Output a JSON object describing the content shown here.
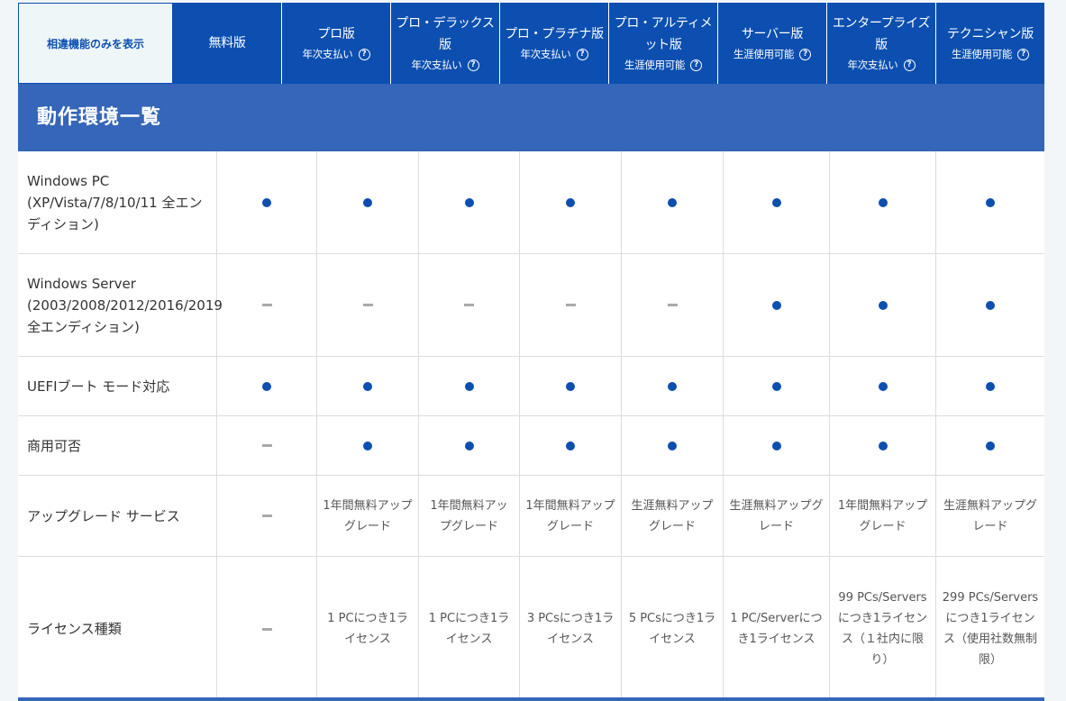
{
  "header": {
    "toggle_label": "相違機能のみを表示",
    "plans": [
      {
        "name": "無料版",
        "sub": ""
      },
      {
        "name": "プロ版",
        "sub": "年次支払い"
      },
      {
        "name": "プロ・デラックス版",
        "sub": "年次支払い"
      },
      {
        "name": "プロ・プラチナ版",
        "sub": "年次支払い"
      },
      {
        "name": "プロ・アルティメット版",
        "sub": "生涯使用可能"
      },
      {
        "name": "サーバー版",
        "sub": "生涯使用可能"
      },
      {
        "name": "エンタープライズ版",
        "sub": "年次支払い"
      },
      {
        "name": "テクニシャン版",
        "sub": "生涯使用可能"
      }
    ]
  },
  "section": {
    "title": "動作環境一覧"
  },
  "rows": [
    {
      "label": "Windows PC (XP/Vista/7/8/10/11 全エンディション)",
      "values": [
        "dot",
        "dot",
        "dot",
        "dot",
        "dot",
        "dot",
        "dot",
        "dot"
      ]
    },
    {
      "label": "Windows Server (2003/2008/2012/2016/2019 全エンディション)",
      "values": [
        "dash",
        "dash",
        "dash",
        "dash",
        "dash",
        "dot",
        "dot",
        "dot"
      ]
    },
    {
      "label": "UEFIブート モード対応",
      "values": [
        "dot",
        "dot",
        "dot",
        "dot",
        "dot",
        "dot",
        "dot",
        "dot"
      ]
    },
    {
      "label": "商用可否",
      "values": [
        "dash",
        "dot",
        "dot",
        "dot",
        "dot",
        "dot",
        "dot",
        "dot"
      ]
    },
    {
      "label": "アップグレード サービス",
      "values": [
        "dash",
        "1年間無料アップグレード",
        "1年間無料アップグレード",
        "1年間無料アップグレード",
        "生涯無料アップグレード",
        "生涯無料アップグレード",
        "1年間無料アップグレード",
        "生涯無料アップグレード"
      ]
    },
    {
      "label": "ライセンス種類",
      "values": [
        "dash",
        "1 PCにつき1ライセンス",
        "1 PCにつき1ライセンス",
        "3 PCsにつき1ライセンス",
        "5 PCsにつき1ライセンス",
        "1 PC/Serverにつき1ライセンス",
        "99 PCs/Serversにつき1ライセンス（１社内に限り）",
        "299 PCs/Serversにつき1ライセンス（使用社数無制限）"
      ]
    }
  ],
  "colors": {
    "header_blue": "#0c4fb0",
    "section_blue": "#3566b9",
    "dot_blue": "#0c4fb0",
    "dash_gray": "#aaaaaa"
  },
  "icons": {
    "help": "question-circle-icon",
    "included": "dot-icon",
    "not_included": "dash-icon"
  }
}
